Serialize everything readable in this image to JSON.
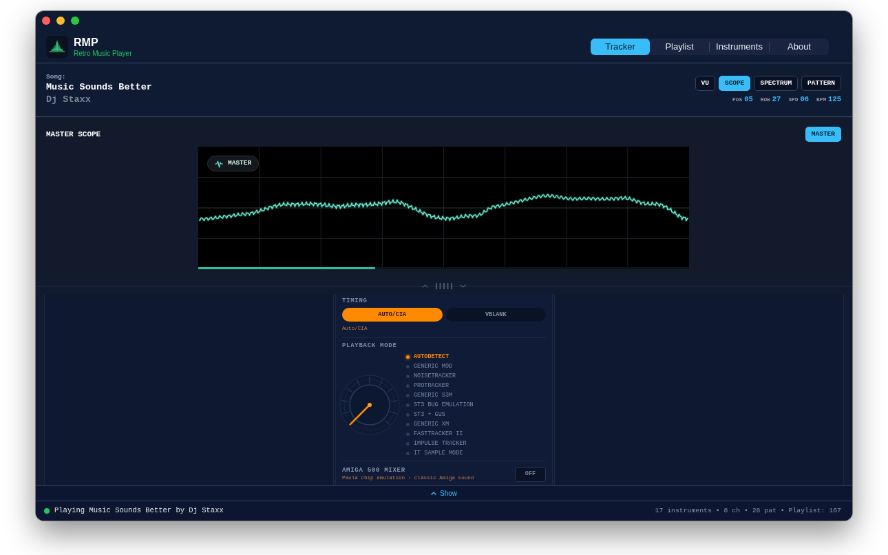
{
  "app": {
    "name": "RMP",
    "subtitle": "Retro Music Player"
  },
  "tabs": [
    {
      "label": "Tracker",
      "selected": true
    },
    {
      "label": "Playlist",
      "selected": false
    },
    {
      "label": "Instruments",
      "selected": false
    },
    {
      "label": "About",
      "selected": false
    }
  ],
  "song": {
    "label": "Song:",
    "title": "Music Sounds Better",
    "artist": "Dj Staxx"
  },
  "view_buttons": [
    {
      "label": "VU",
      "selected": false
    },
    {
      "label": "SCOPE",
      "selected": true
    },
    {
      "label": "SPECTRUM",
      "selected": false
    },
    {
      "label": "PATTERN",
      "selected": false
    }
  ],
  "readouts": [
    {
      "label": "POS",
      "value": "05"
    },
    {
      "label": "ROW",
      "value": "27"
    },
    {
      "label": "SPD",
      "value": "06"
    },
    {
      "label": "BPM",
      "value": "125"
    }
  ],
  "scope": {
    "title": "MASTER SCOPE",
    "channel_button": {
      "label": "MASTER",
      "selected": true
    },
    "channel_badge": "MASTER",
    "progress": {
      "level": 0.36
    }
  },
  "timing": {
    "label": "TIMING",
    "options": [
      {
        "label": "AUTO/CIA",
        "selected": true
      },
      {
        "label": "VBLANK",
        "selected": false
      }
    ],
    "current": "Auto/CIA"
  },
  "playback_mode": {
    "label": "PLAYBACK MODE",
    "modes": [
      {
        "label": "AUTODETECT",
        "selected": true
      },
      {
        "label": "GENERIC MOD",
        "selected": false
      },
      {
        "label": "NOISETRACKER",
        "selected": false
      },
      {
        "label": "PROTRACKER",
        "selected": false
      },
      {
        "label": "GENERIC S3M",
        "selected": false
      },
      {
        "label": "ST3 BUG EMULATION",
        "selected": false
      },
      {
        "label": "ST3 + GUS",
        "selected": false
      },
      {
        "label": "GENERIC XM",
        "selected": false
      },
      {
        "label": "FASTTRACKER II",
        "selected": false
      },
      {
        "label": "IMPULSE TRACKER",
        "selected": false
      },
      {
        "label": "IT SAMPLE MODE",
        "selected": false
      }
    ]
  },
  "mixer": {
    "title": "AMIGA 500 MIXER",
    "description": "Paula chip emulation · classic Amiga sound",
    "toggle": {
      "label": "OFF",
      "on": false
    }
  },
  "show_button": {
    "label": "Show"
  },
  "status_bar": {
    "playing": true,
    "message": "Playing Music Sounds Better by Dj Staxx",
    "stats": "17 instruments • 8 ch • 28 pat • Playlist: 167"
  }
}
